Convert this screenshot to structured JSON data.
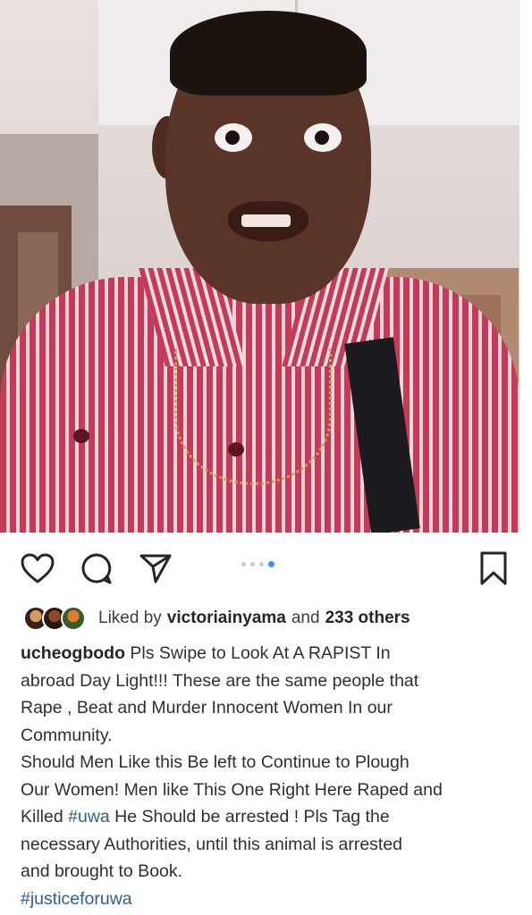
{
  "post": {
    "likes": {
      "prefix": "Liked by",
      "user": "victoriainyama",
      "and": "and",
      "others": "233 others"
    },
    "caption": {
      "username": "ucheogbodo",
      "line1": "Pls Swipe to Look At A RAPIST In",
      "line2": "abroad Day Light!!! These are the same people that",
      "line3": "Rape , Beat and Murder Innocent Women In our",
      "line4": "Community.",
      "line5": "Should Men Like this Be left to Continue to Plough",
      "line6": "Our Women! Men like This One Right Here Raped and",
      "line7_pre": "Killed",
      "line7_tag": "#uwa",
      "line7_post": "He Should be arrested ! Pls Tag the",
      "line8": "necessary Authorities, until this animal is arrested",
      "line9": "and brought to Book.",
      "hashtag": "#justiceforuwa"
    },
    "carousel": {
      "count": 4,
      "active_index": 3
    },
    "icons": [
      "heart-icon",
      "comment-icon",
      "share-icon",
      "bookmark-icon"
    ],
    "colors": {
      "accent": "#3897f0",
      "hashtag": "#2f5f8f",
      "text": "#262626"
    }
  }
}
